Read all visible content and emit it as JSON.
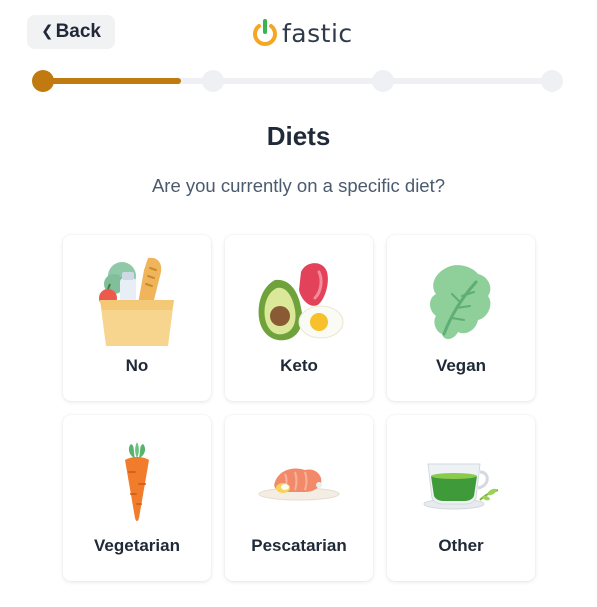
{
  "header": {
    "back_label": "Back",
    "logo_text": "fastic"
  },
  "progress": {
    "current_step": 1,
    "total_steps": 4,
    "fraction": 0.27
  },
  "title": "Diets",
  "subtitle": "Are you currently on a specific diet?",
  "options": [
    {
      "label": "No",
      "icon": "grocery-bag-icon"
    },
    {
      "label": "Keto",
      "icon": "keto-food-icon"
    },
    {
      "label": "Vegan",
      "icon": "lettuce-leaf-icon"
    },
    {
      "label": "Vegetarian",
      "icon": "carrot-icon"
    },
    {
      "label": "Pescatarian",
      "icon": "fish-plate-icon"
    },
    {
      "label": "Other",
      "icon": "tea-cup-icon"
    }
  ],
  "colors": {
    "accent": "#c07a0f",
    "logo_orange": "#f5a623",
    "logo_green": "#39b54a"
  }
}
